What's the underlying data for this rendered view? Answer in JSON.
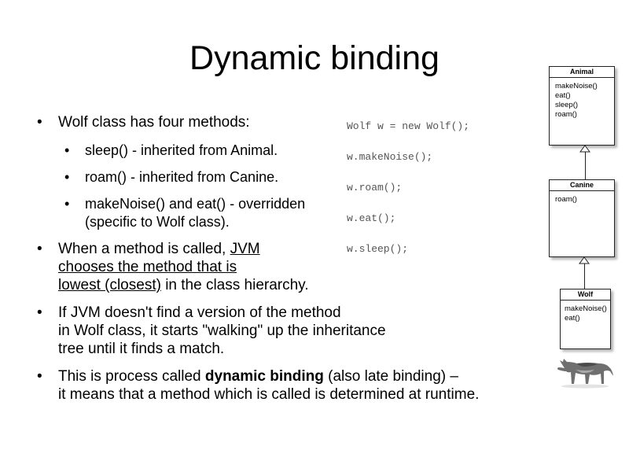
{
  "title": "Dynamic binding",
  "bullets": {
    "b1": "Wolf class has four methods:",
    "sub1": "sleep() - inherited from Animal.",
    "sub2": "roam() - inherited from Canine.",
    "sub3_line1": "makeNoise() and eat() - overridden",
    "sub3_line2": "(specific to Wolf class).",
    "b2_pre": "When a method is called, ",
    "b2_u1": "JVM ",
    "b2_u2": "chooses the method that is ",
    "b2_u3": "lowest (closest)",
    "b2_post": " in the class hierarchy.",
    "b3_line1": "If JVM doesn't find a version of the method",
    "b3_line2": "in Wolf class, it starts \"walking\" up the inheritance",
    "b3_line3": "tree until it finds a match.",
    "b4_pre": "This is process called ",
    "b4_bold": "dynamic binding",
    "b4_post": " (also late binding) –",
    "b4_line2": "it means that a method which is called is determined at runtime.",
    "marker": "•"
  },
  "code": {
    "line1": "Wolf w = new Wolf();",
    "line2": "w.makeNoise();",
    "line3": "w.roam();",
    "line4": "w.eat();",
    "line5": "w.sleep();"
  },
  "uml": {
    "animal": {
      "name": "Animal",
      "methods": [
        "makeNoise()",
        "eat()",
        "sleep()",
        "roam()"
      ]
    },
    "canine": {
      "name": "Canine",
      "methods": [
        "roam()"
      ]
    },
    "wolf": {
      "name": "Wolf",
      "methods": [
        "makeNoise()",
        "eat()"
      ]
    }
  },
  "icons": {
    "wolf_image": "wolf-photo-icon"
  }
}
